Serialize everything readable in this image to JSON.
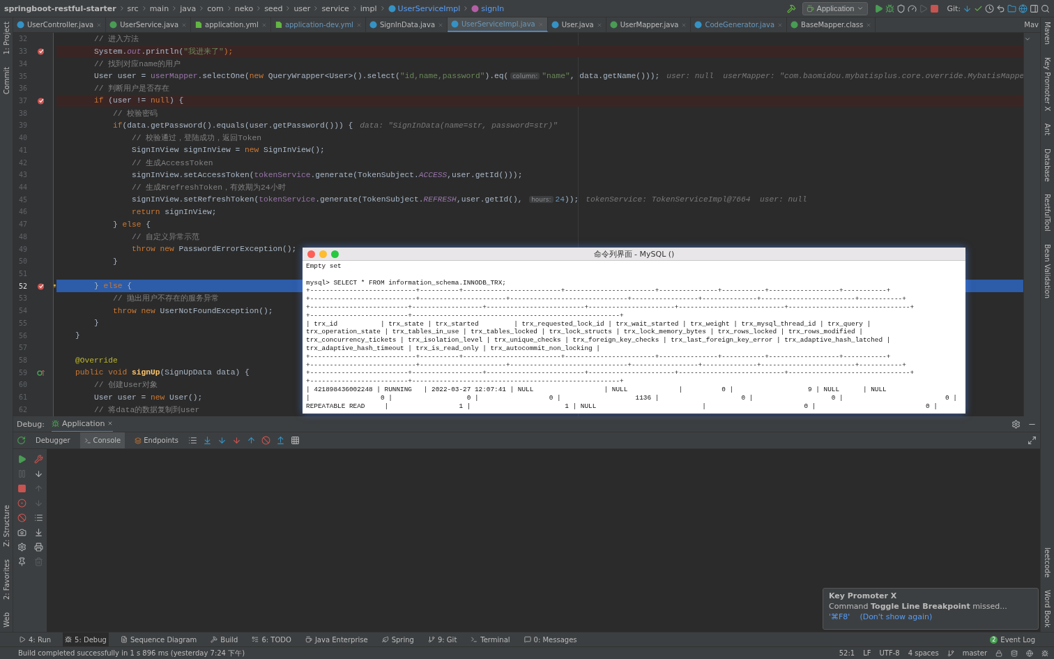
{
  "breadcrumbs": [
    {
      "label": "springboot-restful-starter",
      "kind": "project"
    },
    {
      "label": "src",
      "kind": "folder"
    },
    {
      "label": "main",
      "kind": "folder"
    },
    {
      "label": "java",
      "kind": "folder"
    },
    {
      "label": "com",
      "kind": "folder"
    },
    {
      "label": "neko",
      "kind": "folder"
    },
    {
      "label": "seed",
      "kind": "folder"
    },
    {
      "label": "user",
      "kind": "folder"
    },
    {
      "label": "service",
      "kind": "folder"
    },
    {
      "label": "impl",
      "kind": "folder"
    },
    {
      "label": "UserServiceImpl",
      "kind": "class"
    },
    {
      "label": "signIn",
      "kind": "method"
    }
  ],
  "toolbar": {
    "run_config": "Application",
    "git_label": "Git:"
  },
  "tabs": [
    {
      "label": "UserController.java",
      "kind": "class",
      "selected": false,
      "modified": false
    },
    {
      "label": "UserService.java",
      "kind": "interface",
      "selected": false,
      "modified": false
    },
    {
      "label": "application.yml",
      "kind": "yml",
      "selected": false,
      "modified": false
    },
    {
      "label": "application-dev.yml",
      "kind": "yml",
      "selected": false,
      "modified": true
    },
    {
      "label": "SignInData.java",
      "kind": "class",
      "selected": false,
      "modified": false
    },
    {
      "label": "UserServiceImpl.java",
      "kind": "class",
      "selected": true,
      "modified": false
    },
    {
      "label": "User.java",
      "kind": "class",
      "selected": false,
      "modified": false
    },
    {
      "label": "UserMapper.java",
      "kind": "interface",
      "selected": false,
      "modified": false
    },
    {
      "label": "CodeGenerator.java",
      "kind": "class",
      "selected": false,
      "modified": true
    },
    {
      "label": "BaseMapper.class",
      "kind": "interface",
      "selected": false,
      "modified": false
    }
  ],
  "side_panel_title": "Mav",
  "left_tools_top": [
    "1: Project",
    "Commit"
  ],
  "left_tools_bottom": [
    "Z: Structure",
    "2: Favorites",
    "Web"
  ],
  "right_tools_top": [
    "Maven",
    "Key Promoter X",
    "Ant",
    "Database",
    "RestfulTool",
    "Bean Validation"
  ],
  "right_tools_bottom": [
    "leetcode",
    "Word Book"
  ],
  "code_lines": [
    {
      "number": "32",
      "breakpoint": false,
      "current": false,
      "segments": [
        {
          "t": "        // 进入方法",
          "kind": "cmt"
        }
      ]
    },
    {
      "number": "33",
      "breakpoint": true,
      "current": false,
      "segments": [
        {
          "t": "        System.",
          "kind": "p"
        },
        {
          "t": "out",
          "kind": "st"
        },
        {
          "t": ".println(",
          "kind": "p"
        },
        {
          "t": "\"我进来了\"",
          "kind": "str"
        },
        {
          "t": ");",
          "kind": "kw"
        }
      ]
    },
    {
      "number": "34",
      "breakpoint": false,
      "current": false,
      "segments": [
        {
          "t": "        // 找到对应name的用户",
          "kind": "cmt"
        }
      ]
    },
    {
      "number": "35",
      "breakpoint": false,
      "current": false,
      "segments": [
        {
          "t": "        User user = ",
          "kind": "p"
        },
        {
          "t": "userMapper",
          "kind": "fld"
        },
        {
          "t": ".selectOne(",
          "kind": "p"
        },
        {
          "t": "new",
          "kind": "kw"
        },
        {
          "t": " QueryWrapper<User>().select(",
          "kind": "p"
        },
        {
          "t": "\"id,name,password\"",
          "kind": "str"
        },
        {
          "t": ").eq(",
          "kind": "p"
        },
        {
          "t": "column:",
          "kind": "inl"
        },
        {
          "t": "\"name\"",
          "kind": "str"
        },
        {
          "t": ", data.getName()));",
          "kind": "p"
        },
        {
          "t": "user: null  userMapper: \"com.baomidou.mybatisplus.core.override.MybatisMappe",
          "kind": "hint"
        }
      ]
    },
    {
      "number": "36",
      "breakpoint": false,
      "current": false,
      "segments": [
        {
          "t": "        // 判断用户是否存在",
          "kind": "cmt"
        }
      ]
    },
    {
      "number": "37",
      "breakpoint": true,
      "current": false,
      "segments": [
        {
          "t": "        if",
          "kind": "kw"
        },
        {
          "t": " (user != ",
          "kind": "p"
        },
        {
          "t": "null",
          "kind": "kw"
        },
        {
          "t": ") {",
          "kind": "p"
        }
      ]
    },
    {
      "number": "38",
      "breakpoint": false,
      "current": false,
      "segments": [
        {
          "t": "            // 校验密码",
          "kind": "cmt"
        }
      ]
    },
    {
      "number": "39",
      "breakpoint": false,
      "current": false,
      "segments": [
        {
          "t": "            if",
          "kind": "kw"
        },
        {
          "t": "(data.getPassword().equals(user.getPassword())) {",
          "kind": "p"
        },
        {
          "t": "data: \"SignInData(name=str, password=str)\"",
          "kind": "hint"
        }
      ]
    },
    {
      "number": "40",
      "breakpoint": false,
      "current": false,
      "segments": [
        {
          "t": "                // 校验通过，登陆成功，返回Token",
          "kind": "cmt"
        }
      ]
    },
    {
      "number": "41",
      "breakpoint": false,
      "current": false,
      "segments": [
        {
          "t": "                SignInView signInView = ",
          "kind": "p"
        },
        {
          "t": "new",
          "kind": "kw"
        },
        {
          "t": " SignInView();",
          "kind": "p"
        }
      ]
    },
    {
      "number": "42",
      "breakpoint": false,
      "current": false,
      "segments": [
        {
          "t": "                // 生成AccessToken",
          "kind": "cmt"
        }
      ]
    },
    {
      "number": "43",
      "breakpoint": false,
      "current": false,
      "segments": [
        {
          "t": "                signInView.setAccessToken(",
          "kind": "p"
        },
        {
          "t": "tokenService",
          "kind": "fld"
        },
        {
          "t": ".generate(TokenSubject.",
          "kind": "p"
        },
        {
          "t": "ACCESS",
          "kind": "st"
        },
        {
          "t": ",user.getId()));",
          "kind": "p"
        }
      ]
    },
    {
      "number": "44",
      "breakpoint": false,
      "current": false,
      "segments": [
        {
          "t": "                // 生成RrefreshToken，有效期为24小时",
          "kind": "cmt"
        }
      ]
    },
    {
      "number": "45",
      "breakpoint": false,
      "current": false,
      "segments": [
        {
          "t": "                signInView.setRefreshToken(",
          "kind": "p"
        },
        {
          "t": "tokenService",
          "kind": "fld"
        },
        {
          "t": ".generate(TokenSubject.",
          "kind": "p"
        },
        {
          "t": "REFRESH",
          "kind": "st"
        },
        {
          "t": ",user.getId(), ",
          "kind": "p"
        },
        {
          "t": "hours:",
          "kind": "inl"
        },
        {
          "t": "24",
          "kind": "num"
        },
        {
          "t": "));",
          "kind": "p"
        },
        {
          "t": "tokenService: TokenServiceImpl@7664  user: null",
          "kind": "hint"
        }
      ]
    },
    {
      "number": "46",
      "breakpoint": false,
      "current": false,
      "segments": [
        {
          "t": "                return",
          "kind": "kw"
        },
        {
          "t": " signInView;",
          "kind": "p"
        }
      ]
    },
    {
      "number": "47",
      "breakpoint": false,
      "current": false,
      "segments": [
        {
          "t": "            } ",
          "kind": "p"
        },
        {
          "t": "else",
          "kind": "kw"
        },
        {
          "t": " {",
          "kind": "p"
        }
      ]
    },
    {
      "number": "48",
      "breakpoint": false,
      "current": false,
      "segments": [
        {
          "t": "                // 自定义异常示范",
          "kind": "cmt"
        }
      ]
    },
    {
      "number": "49",
      "breakpoint": false,
      "current": false,
      "segments": [
        {
          "t": "                throw new",
          "kind": "kw"
        },
        {
          "t": " PasswordErrorException();",
          "kind": "p"
        }
      ]
    },
    {
      "number": "50",
      "breakpoint": false,
      "current": false,
      "segments": [
        {
          "t": "            }",
          "kind": "p"
        }
      ]
    },
    {
      "number": "51",
      "breakpoint": false,
      "current": false
    },
    {
      "number": "52",
      "breakpoint": true,
      "current": true,
      "gutter": {
        "kind": "bulb"
      },
      "segments": [
        {
          "t": "        } ",
          "kind": "p"
        },
        {
          "t": "else",
          "kind": "kw"
        },
        {
          "t": " {",
          "kind": "p"
        }
      ]
    },
    {
      "number": "53",
      "breakpoint": false,
      "current": false,
      "segments": [
        {
          "t": "            // 抛出用户不存在的服务异常",
          "kind": "cmt"
        }
      ]
    },
    {
      "number": "54",
      "breakpoint": false,
      "current": false,
      "segments": [
        {
          "t": "            throw new",
          "kind": "kw"
        },
        {
          "t": " UserNotFoundException();",
          "kind": "p"
        }
      ]
    },
    {
      "number": "55",
      "breakpoint": false,
      "current": false,
      "segments": [
        {
          "t": "        }",
          "kind": "p"
        }
      ]
    },
    {
      "number": "56",
      "breakpoint": false,
      "current": false,
      "segments": [
        {
          "t": "    }",
          "kind": "p"
        }
      ]
    },
    {
      "number": "57",
      "breakpoint": false,
      "current": false
    },
    {
      "number": "58",
      "breakpoint": false,
      "current": false,
      "segments": [
        {
          "t": "    @Override",
          "kind": "ann"
        }
      ]
    },
    {
      "number": "59",
      "breakpoint": false,
      "current": false,
      "gutter": {
        "kind": "override"
      },
      "segments": [
        {
          "t": "    public void ",
          "kind": "kw"
        },
        {
          "t": "signUp",
          "kind": "fn"
        },
        {
          "t": "(SignUpData data) {",
          "kind": "p"
        }
      ]
    },
    {
      "number": "60",
      "breakpoint": false,
      "current": false,
      "segments": [
        {
          "t": "        // 创建User对象",
          "kind": "cmt"
        }
      ]
    },
    {
      "number": "61",
      "breakpoint": false,
      "current": false,
      "segments": [
        {
          "t": "        User user = ",
          "kind": "p"
        },
        {
          "t": "new",
          "kind": "kw"
        },
        {
          "t": " User();",
          "kind": "p"
        }
      ]
    },
    {
      "number": "62",
      "breakpoint": false,
      "current": false,
      "segments": [
        {
          "t": "        // 将data的数据复制到user",
          "kind": "cmt"
        }
      ]
    }
  ],
  "mysql_window": {
    "title": "命令列界面 - MySQL ()",
    "output": [
      "Empty set"
    ],
    "command": "mysql> SELECT * FROM information_schema.INNODB_TRX;",
    "table_lines": [
      "+---------------------------+----------+-------------------------+-----------------------+---------------+-----------+------------------+-----------+",
      "+---------------------------+----------------------+------------------------------+-----------------+--------------+------------------------+-----------+",
      "+-------------------------+------------------+-------------------------+----------------------+---------------------------+-------------------------------+",
      "+-------------------------+-----------------------------------------------------+",
      "| trx_id           | trx_state | trx_started         | trx_requested_lock_id | trx_wait_started | trx_weight | trx_mysql_thread_id | trx_query |",
      "trx_operation_state | trx_tables_in_use | trx_tables_locked | trx_lock_structs | trx_lock_memory_bytes | trx_rows_locked | trx_rows_modified |",
      "trx_concurrency_tickets | trx_isolation_level | trx_unique_checks | trx_foreign_key_checks | trx_last_foreign_key_error | trx_adaptive_hash_latched |",
      "trx_adaptive_hash_timeout | trx_is_read_only | trx_autocommit_non_locking |",
      "+---------------------------+----------+-------------------------+-----------------------+---------------+-----------+------------------+-----------+",
      "+---------------------------+----------------------+------------------------------+-----------------+--------------+------------------------+-----------+",
      "+-------------------------+------------------+-------------------------+----------------------+---------------------------+-------------------------------+",
      "+-------------------------+-----------------------------------------------------+",
      "| 421898436002248 | RUNNING   | 2022-03-27 12:07:41 | NULL                  | NULL             |          0 |                   9 | NULL      | NULL",
      "|                  0 |                   0 |                  0 |                   1136 |                     0 |                    0 |                          0 |",
      "REPEATABLE READ     |                  1 |                        1 | NULL                           |                         0 |                            0 |"
    ]
  },
  "debug": {
    "label": "Debug:",
    "session": "Application",
    "subtabs": [
      {
        "label": "Debugger",
        "selected": false
      },
      {
        "label": "Console",
        "selected": true
      },
      {
        "label": "Endpoints",
        "selected": false
      }
    ]
  },
  "notification": {
    "title": "Key Promoter X",
    "message": "Command **Toggle Line Breakpoint** missed...",
    "shortcut": "'⌘F8'",
    "action": "(Don't show again)"
  },
  "tool_buttons": [
    {
      "label": "4: Run",
      "selected": false
    },
    {
      "label": "5: Debug",
      "selected": true
    },
    {
      "label": "Sequence Diagram",
      "selected": false
    },
    {
      "label": "Build",
      "selected": false
    },
    {
      "label": "6: TODO",
      "selected": false
    },
    {
      "label": "Java Enterprise",
      "selected": false
    },
    {
      "label": "Spring",
      "selected": false
    },
    {
      "label": "9: Git",
      "selected": false
    },
    {
      "label": "Terminal",
      "selected": false
    },
    {
      "label": "0: Messages",
      "selected": false
    }
  ],
  "event_log": {
    "label": "Event Log",
    "badge": "2"
  },
  "status_bar": {
    "message": "Build completed successfully in 1 s 896 ms (yesterday 7:24 下午)",
    "position": "52:1",
    "line_ending": "LF",
    "encoding": "UTF-8",
    "indent": "4 spaces",
    "branch": "master"
  }
}
